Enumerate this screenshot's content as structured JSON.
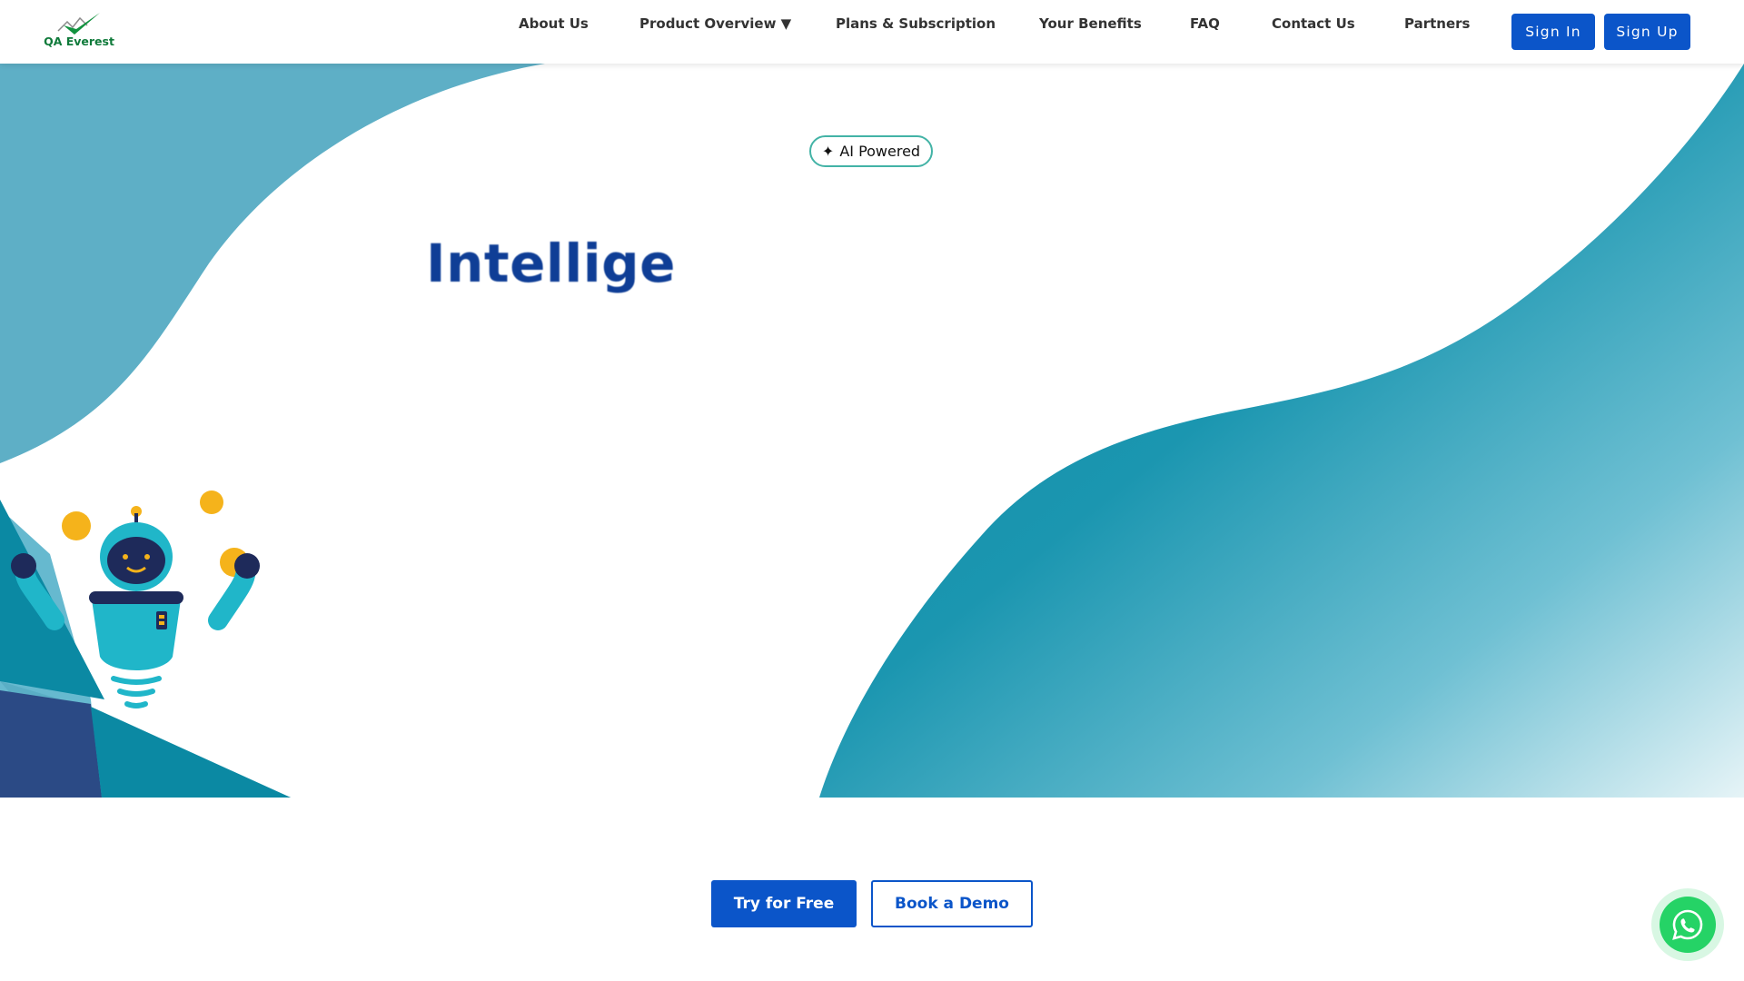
{
  "brand": {
    "logo_text": "QA Everest"
  },
  "nav": {
    "items": [
      {
        "label": "About Us"
      },
      {
        "label": "Product Overview ▼"
      },
      {
        "label": "Plans & Subscription"
      },
      {
        "label": "Your Benefits"
      },
      {
        "label": "FAQ"
      },
      {
        "label": "Contact Us"
      },
      {
        "label": "Partners"
      }
    ],
    "sign_in": "Sign In",
    "sign_up": "Sign Up"
  },
  "hero": {
    "badge_icon": "✦",
    "badge_label": "AI Powered",
    "title": "Intellige"
  },
  "cta": {
    "primary": "Try for Free",
    "secondary": "Book a Demo"
  },
  "icons": [
    "logo-check-icon",
    "sparkle-icon",
    "robot-illustration",
    "whatsapp-icon"
  ],
  "colors": {
    "primary": "#0b55c9",
    "teal": "#0d8ba5",
    "teal_light": "#5aaec5",
    "navy": "#2b4a85",
    "logo_green": "#0f7a3a",
    "whatsapp": "#25d366"
  }
}
